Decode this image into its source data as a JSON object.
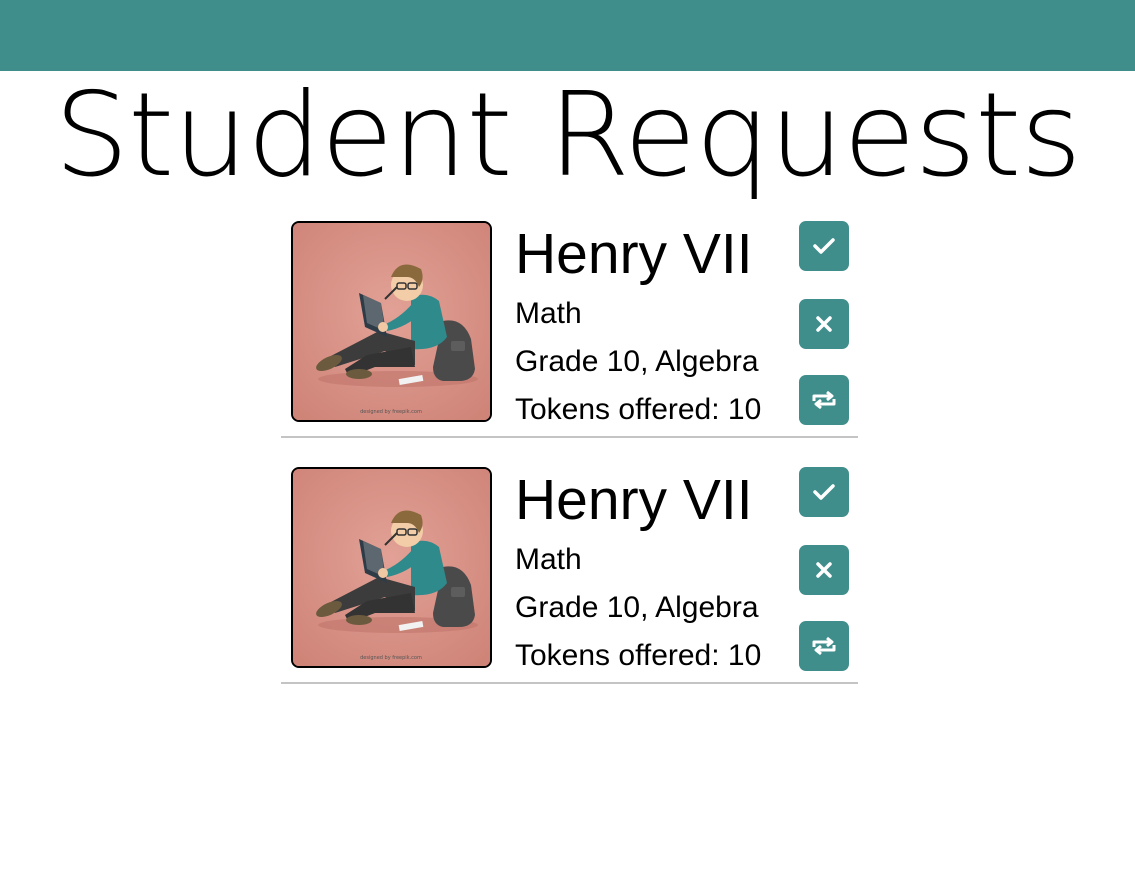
{
  "header": {
    "color": "#3f8e8c",
    "title": "Student Requests"
  },
  "requests": [
    {
      "name": "Henry VII",
      "subject": "Math",
      "grade_topic": "Grade 10, Algebra",
      "tokens": "Tokens offered: 10",
      "photo_icon": "student-reading-illustration",
      "photo_credit": "designed by freepik.com",
      "actions": [
        "check-icon",
        "close-icon",
        "repeat-icon"
      ]
    },
    {
      "name": "Henry VII",
      "subject": "Math",
      "grade_topic": "Grade 10, Algebra",
      "tokens": "Tokens offered: 10",
      "photo_icon": "student-reading-illustration",
      "photo_credit": "designed by freepik.com",
      "actions": [
        "check-icon",
        "close-icon",
        "repeat-icon"
      ]
    }
  ]
}
